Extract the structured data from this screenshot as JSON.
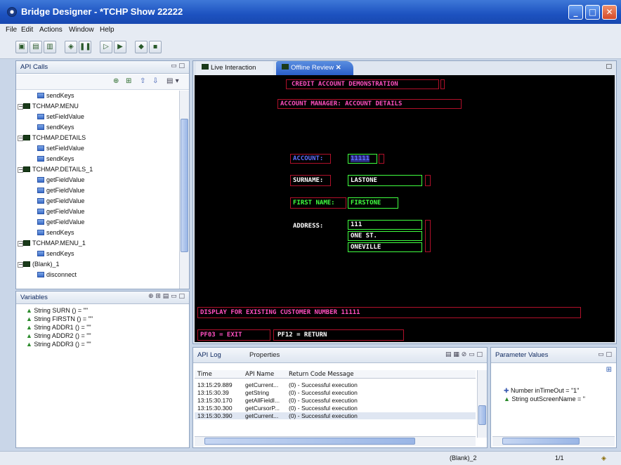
{
  "window": {
    "title": "Bridge Designer - *TCHP Show 22222"
  },
  "menu": [
    "File",
    "Edit",
    "Actions",
    "Window",
    "Help"
  ],
  "api_calls": {
    "title": "API Calls",
    "items": [
      {
        "label": "sendKeys",
        "type": "method",
        "indent": 2
      },
      {
        "label": "TCHMAP.MENU",
        "type": "screen",
        "indent": 1
      },
      {
        "label": "setFieldValue",
        "type": "method",
        "indent": 2
      },
      {
        "label": "sendKeys",
        "type": "method",
        "indent": 2
      },
      {
        "label": "TCHMAP.DETAILS",
        "type": "screen",
        "indent": 1
      },
      {
        "label": "setFieldValue",
        "type": "method",
        "indent": 2
      },
      {
        "label": "sendKeys",
        "type": "method",
        "indent": 2
      },
      {
        "label": "TCHMAP.DETAILS_1",
        "type": "screen",
        "indent": 1
      },
      {
        "label": "getFieldValue",
        "type": "method",
        "indent": 2
      },
      {
        "label": "getFieldValue",
        "type": "method",
        "indent": 2
      },
      {
        "label": "getFieldValue",
        "type": "method",
        "indent": 2
      },
      {
        "label": "getFieldValue",
        "type": "method",
        "indent": 2
      },
      {
        "label": "getFieldValue",
        "type": "method",
        "indent": 2
      },
      {
        "label": "sendKeys",
        "type": "method",
        "indent": 2
      },
      {
        "label": "TCHMAP.MENU_1",
        "type": "screen",
        "indent": 1
      },
      {
        "label": "sendKeys",
        "type": "method",
        "indent": 2
      },
      {
        "label": "(Blank)_1",
        "type": "screen",
        "indent": 1
      },
      {
        "label": "disconnect",
        "type": "method",
        "indent": 2
      }
    ]
  },
  "variables": {
    "title": "Variables",
    "items": [
      "String SURN () = \"\"",
      "String FIRSTN () = \"\"",
      "String ADDR1 () = \"\"",
      "String ADDR2 () = \"\"",
      "String ADDR3 () = \"\""
    ]
  },
  "editor_tabs": {
    "live": "Live Interaction",
    "offline": "Offline Review"
  },
  "terminal": {
    "header": "CREDIT ACCOUNT DEMONSTRATION",
    "subheader": "ACCOUNT MANAGER: ACCOUNT DETAILS",
    "account_label": "ACCOUNT:",
    "account_value": "11111",
    "surname_label": "SURNAME:",
    "surname_value": "LASTONE",
    "firstname_label": "FIRST NAME:",
    "firstname_value": "FIRSTONE",
    "address_label": "ADDRESS:",
    "address1": "111",
    "address2": "ONE ST.",
    "address3": "ONEVILLE",
    "message": "DISPLAY FOR EXISTING CUSTOMER NUMBER 11111",
    "pf3": "PF03 = EXIT",
    "pf12": "PF12 = RETURN"
  },
  "api_log": {
    "title": "API Log",
    "properties_tab": "Properties",
    "columns": [
      "Time",
      "API Name",
      "Return Code Message"
    ],
    "rows": [
      [
        "13:15:29.889",
        "getCurrent...",
        "(0) - Successful execution"
      ],
      [
        "13:15:30.39",
        "getString",
        "(0) - Successful execution"
      ],
      [
        "13:15:30.170",
        "getAllFieldI...",
        "(0) - Successful execution"
      ],
      [
        "13:15:30.300",
        "getCursorP...",
        "(0) - Successful execution"
      ],
      [
        "13:15:30.390",
        "getCurrent...",
        "(0) - Successful execution"
      ]
    ]
  },
  "parameters": {
    "title": "Parameter Values",
    "items": [
      "Number inTimeOut = \"1\"",
      "String outScreenName = \""
    ]
  },
  "status": {
    "screen": "(Blank)_2",
    "page": "1/1"
  },
  "colors": {
    "terminal_bg": "#000000",
    "pink": "#ff4fbf",
    "green": "#40ff40",
    "blue": "#6070ff",
    "white": "#ffffff",
    "red_box": "#b0102a"
  }
}
